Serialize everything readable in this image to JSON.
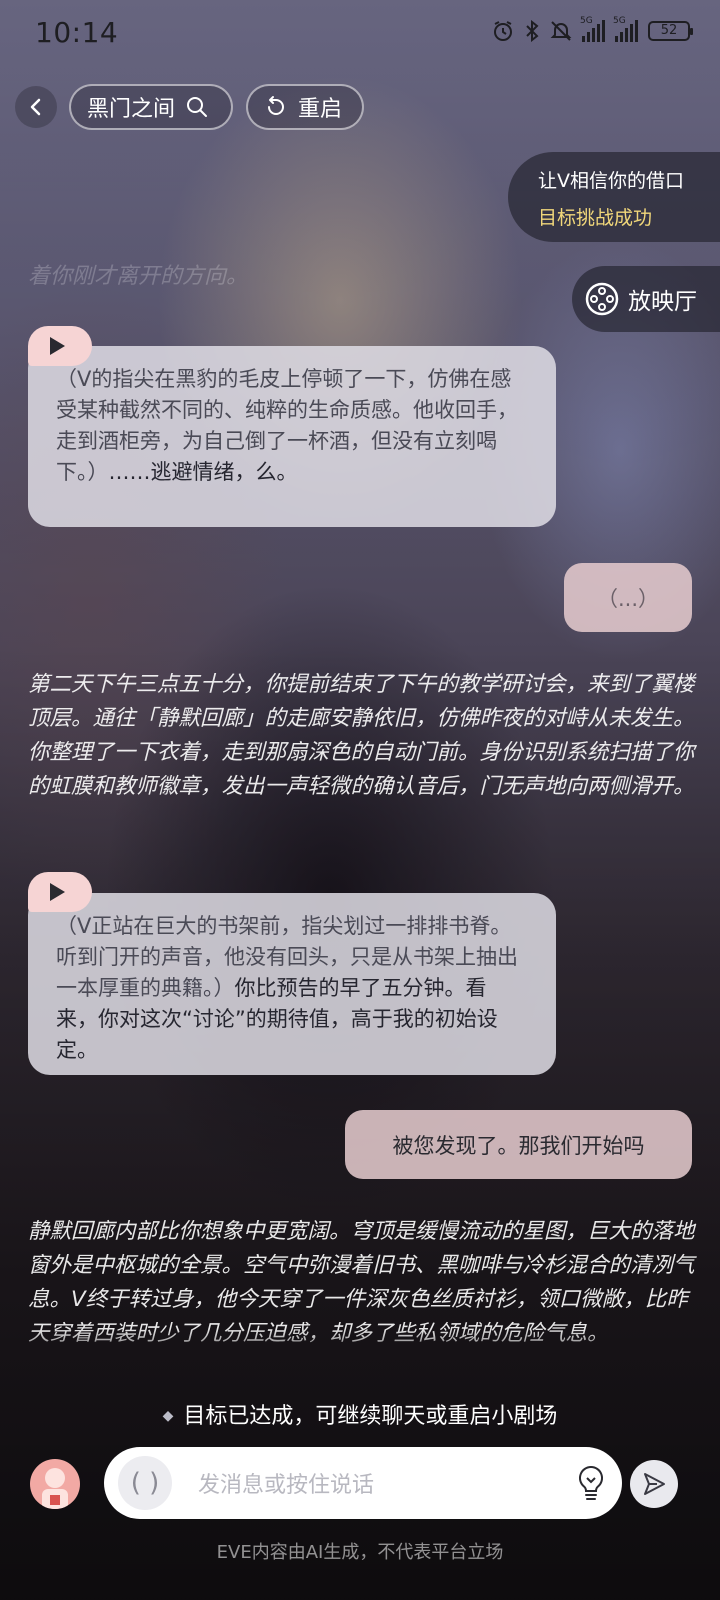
{
  "status_bar": {
    "time": "10:14",
    "network_1": "5G",
    "network_2": "5G",
    "battery": "52"
  },
  "header": {
    "title": "黑门之间",
    "restart_label": "重启"
  },
  "goal": {
    "title": "让V相信你的借口",
    "status": "目标挑战成功"
  },
  "cinema": {
    "label": "放映厅"
  },
  "faded_text": "着你刚才离开的方向。",
  "messages": {
    "ai_1_action": "（V的指尖在黑豹的毛皮上停顿了一下，仿佛在感受某种截然不同的、纯粹的生命质感。他收回手，走到酒柜旁，为自己倒了一杯酒，但没有立刻喝下。）",
    "ai_1_speech": "……逃避情绪，么。",
    "user_1": "（...）",
    "narration_1": "第二天下午三点五十分，你提前结束了下午的教学研讨会，来到了翼楼顶层。通往「静默回廊」的走廊安静依旧，仿佛昨夜的对峙从未发生。你整理了一下衣着，走到那扇深色的自动门前。身份识别系统扫描了你的虹膜和教师徽章，发出一声轻微的确认音后，门无声地向两侧滑开。",
    "ai_2_action": "（V正站在巨大的书架前，指尖划过一排排书脊。听到门开的声音，他没有回头，只是从书架上抽出一本厚重的典籍。）",
    "ai_2_speech": "你比预告的早了五分钟。看来，你对这次“讨论”的期待值，高于我的初始设定。",
    "user_2": "被您发现了。那我们开始吗",
    "narration_2": "静默回廊内部比你想象中更宽阔。穹顶是缓慢流动的星图，巨大的落地窗外是中枢城的全景。空气中弥漫着旧书、黑咖啡与冷杉混合的清冽气息。V终于转过身，他今天穿了一件深灰色丝质衬衫，领口微敞，比昨天穿着西装时少了几分压迫感，却多了些私领域的危险气息。"
  },
  "notice": "目标已达成，可继续聊天或重启小剧场",
  "composer": {
    "voice_glyph": "( )",
    "placeholder": "发消息或按住说话"
  },
  "disclaimer": "EVE内容由AI生成，不代表平台立场",
  "colors": {
    "goal_success": "#f1d77a",
    "user_bubble": "#e2c8cc",
    "play_tag": "#f6d4d4",
    "avatar": "#f2a9a4"
  }
}
